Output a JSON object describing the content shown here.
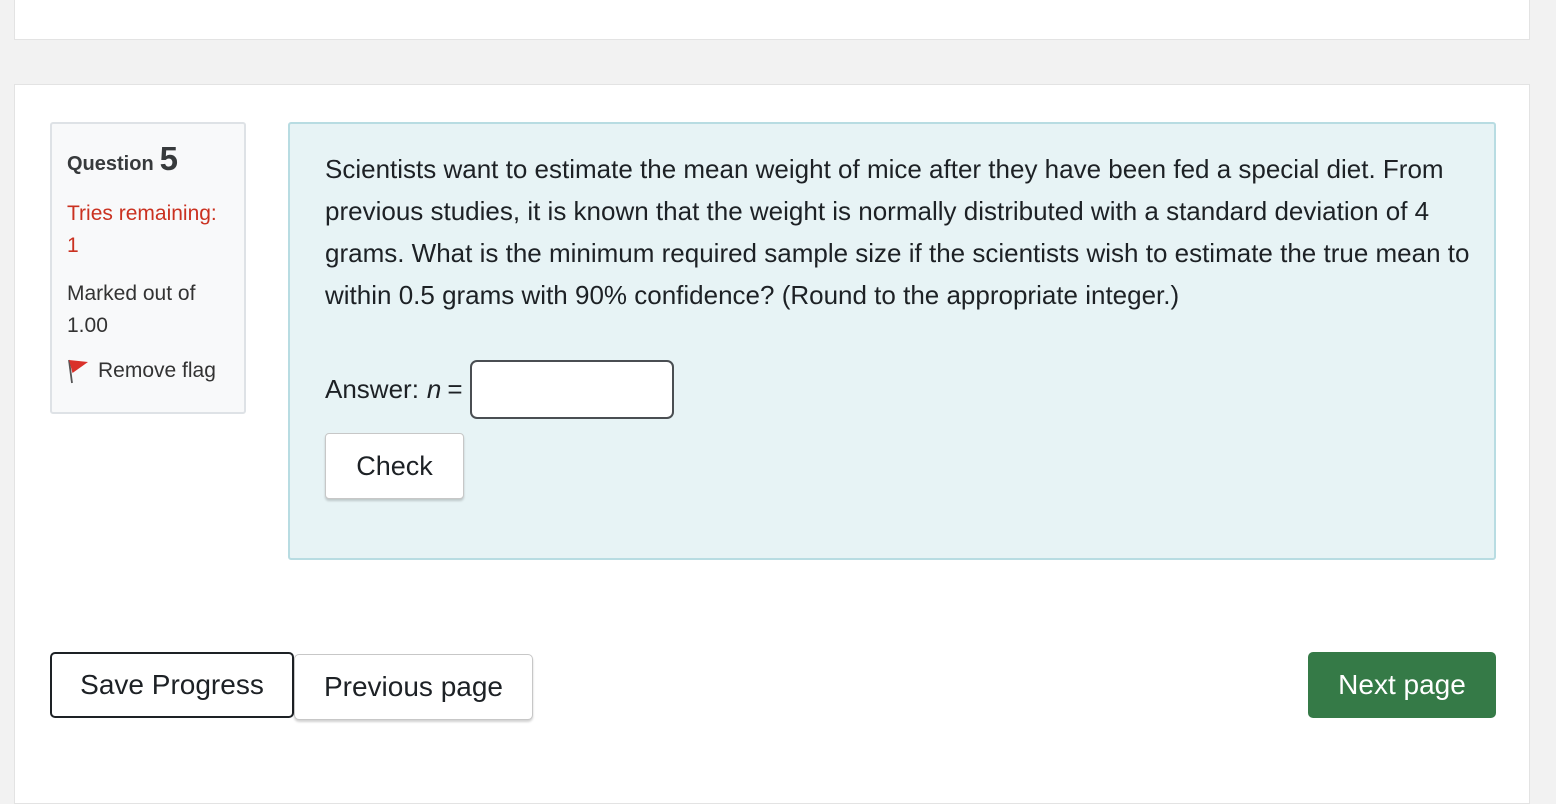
{
  "question_info": {
    "label": "Question",
    "number": "5",
    "tries_label": "Tries remaining:",
    "tries_value": "1",
    "marked_label": "Marked out of",
    "marked_value": "1.00",
    "flag_label": "Remove flag",
    "flag_icon": "flag-icon",
    "flag_color": "#d9312a"
  },
  "question": {
    "text": "Scientists want to estimate the mean weight of mice after they have been fed a special diet. From previous studies, it is known that the weight is normally distributed with a standard deviation of 4 grams. What is the minimum required sample size if the scientists wish to estimate the true mean to within 0.5 grams with 90% confidence? (Round to the appropriate integer.)",
    "answer_label": "Answer:",
    "answer_var": "n",
    "answer_eq": "=",
    "answer_value": "",
    "check_label": "Check"
  },
  "navigation": {
    "save_label": "Save Progress",
    "prev_label": "Previous page",
    "next_label": "Next page",
    "next_color": "#357a47"
  }
}
